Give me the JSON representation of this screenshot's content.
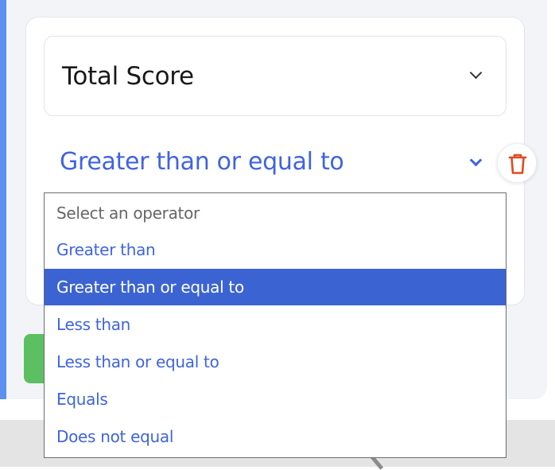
{
  "metric_select": {
    "value": "Total Score"
  },
  "operator_select": {
    "value": "Greater than or equal to",
    "options": [
      "Select an operator",
      "Greater than",
      "Greater than or equal to",
      "Less than",
      "Less than or equal to",
      "Equals",
      "Does not equal"
    ],
    "selected_index": 2
  },
  "delete_button": {
    "icon": "trash-icon"
  },
  "colors": {
    "accent_blue": "#3f64de",
    "selected_option_bg": "#3b63d2",
    "delete_red": "#e04a1f",
    "side_accent": "#5b8ff0",
    "button_green": "#5cbf62"
  }
}
